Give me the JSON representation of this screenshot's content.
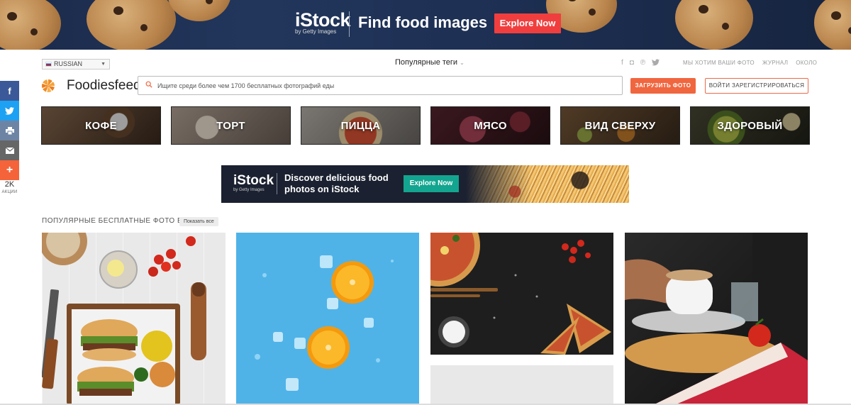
{
  "top_banner": {
    "brand": "iStock",
    "brand_sub": "by Getty Images",
    "headline": "Find food images",
    "cta": "Explore Now"
  },
  "share": {
    "count": "2K",
    "count_label": "АКЦИИ",
    "colors": {
      "facebook": "#3b5998",
      "twitter": "#1da1f2",
      "print": "#6d84a4",
      "email": "#666666",
      "more": "#f4633a"
    }
  },
  "header": {
    "language": "RUSSIAN",
    "popular_tags": "Популярные теги",
    "links": [
      "МЫ ХОТИМ ВАШИ ФОТО",
      "ЖУРНАЛ",
      "ОКОЛО"
    ],
    "logo": "Foodiesfeed",
    "search_placeholder": "Ищите среди более чем 1700 бесплатных фотографий еды",
    "upload_label": "ЗАГРУЗИТЬ ФОТО",
    "login_label": "ВОЙТИ ЗАРЕГИСТРИРОВАТЬСЯ",
    "accent": "#f0663f"
  },
  "categories": [
    "КОФЕ",
    "ТОРТ",
    "ПИЦЦА",
    "МЯСО",
    "ВИД СВЕРХУ",
    "ЗДОРОВЫЙ"
  ],
  "mid_ad": {
    "brand": "iStock",
    "brand_sub": "by Getty Images",
    "line1": "Discover delicious food",
    "line2": "photos on iStock",
    "cta": "Explore Now"
  },
  "popular": {
    "title": "ПОПУЛЯРНЫЕ БЕСПЛАТНЫЕ ФОТО ЕДЫ",
    "show_all": "Показать все"
  }
}
